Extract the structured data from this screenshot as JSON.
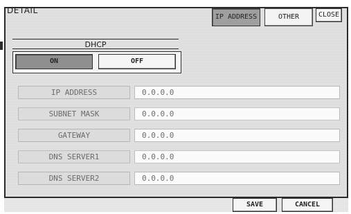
{
  "window": {
    "title": "DETAIL"
  },
  "tabs": {
    "ip_address": "IP ADDRESS",
    "other": "OTHER"
  },
  "close_label": "CLOSE",
  "dhcp": {
    "label": "DHCP",
    "on": "ON",
    "off": "OFF",
    "selected": "ON"
  },
  "fields": [
    {
      "label": "IP ADDRESS",
      "value": "0.0.0.0"
    },
    {
      "label": "SUBNET MASK",
      "value": "0.0.0.0"
    },
    {
      "label": "GATEWAY",
      "value": "0.0.0.0"
    },
    {
      "label": "DNS SERVER1",
      "value": "0.0.0.0"
    },
    {
      "label": "DNS SERVER2",
      "value": "0.0.0.0"
    }
  ],
  "footer": {
    "save": "SAVE",
    "cancel": "CANCEL"
  }
}
